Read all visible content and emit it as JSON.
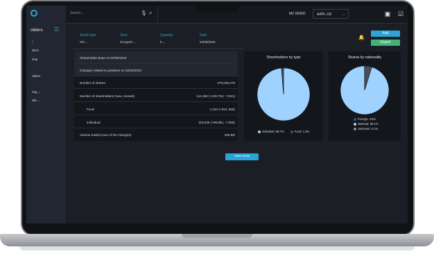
{
  "sidebar": {
    "title": "olders",
    "items": [
      {
        "label": "y",
        "active": true
      },
      {
        "label": "istics",
        "active": false
      },
      {
        "label": "ship",
        "active": false
      },
      {
        "label": "",
        "active": false
      },
      {
        "label": "olders",
        "active": false
      },
      {
        "label": "ring",
        "active": false
      },
      {
        "label": "ails",
        "active": false
      }
    ]
  },
  "topbar": {
    "search_placeholder": "Search...",
    "account": "MZ DEMO",
    "ticker": "AAPL-US"
  },
  "filters": [
    {
      "label": "Stock type",
      "value": "ON"
    },
    {
      "label": "View",
      "value": "Grouped"
    },
    {
      "label": "Quantity",
      "value": "5"
    },
    {
      "label": "Date",
      "value": "02/08/2023"
    }
  ],
  "actions": {
    "add": "Add",
    "export": "Export",
    "view_more": "View more"
  },
  "table": {
    "title": "Shareholder Base on 02/08/2023",
    "subtitle": "Changes related to positions on 02/02/2023",
    "rows": [
      {
        "label": "Number of shares:",
        "value": "270,029,279",
        "indent": false
      },
      {
        "label": "Number of shareholders (new; zeroed):",
        "value": "112,363 (+100,793; -7,931)",
        "indent": false
      },
      {
        "label": "Fund:",
        "value": "1,424 (+912; 866)",
        "indent": true
      },
      {
        "label": "Individual:",
        "value": "110,939 (+99,881; -7,065)",
        "indent": true
      },
      {
        "label": "Volume traded (sum of the changes):",
        "value": "255.8M",
        "indent": false
      }
    ]
  },
  "chart_data": [
    {
      "type": "pie",
      "title": "Shareholders by type",
      "categories": [
        "Individual",
        "Fund"
      ],
      "values": [
        98.7,
        1.3
      ],
      "labels": [
        "Individual: 98.7%",
        "Fund: 1.3%"
      ],
      "colors": [
        "#9fd2ff",
        "#4a4f5a"
      ],
      "legend": "bottom"
    },
    {
      "type": "pie",
      "title": "Shares by nationality",
      "categories": [
        "Foreign",
        "National",
        "Unknown"
      ],
      "values": [
        4.8,
        95.1,
        0.1
      ],
      "labels": [
        "Foreign: 4.8%",
        "National: 95.1%",
        "Unknown: 0.1%"
      ],
      "colors": [
        "#4a4f5a",
        "#9fd2ff",
        "#8a8f98"
      ],
      "legend": "bottom"
    }
  ]
}
